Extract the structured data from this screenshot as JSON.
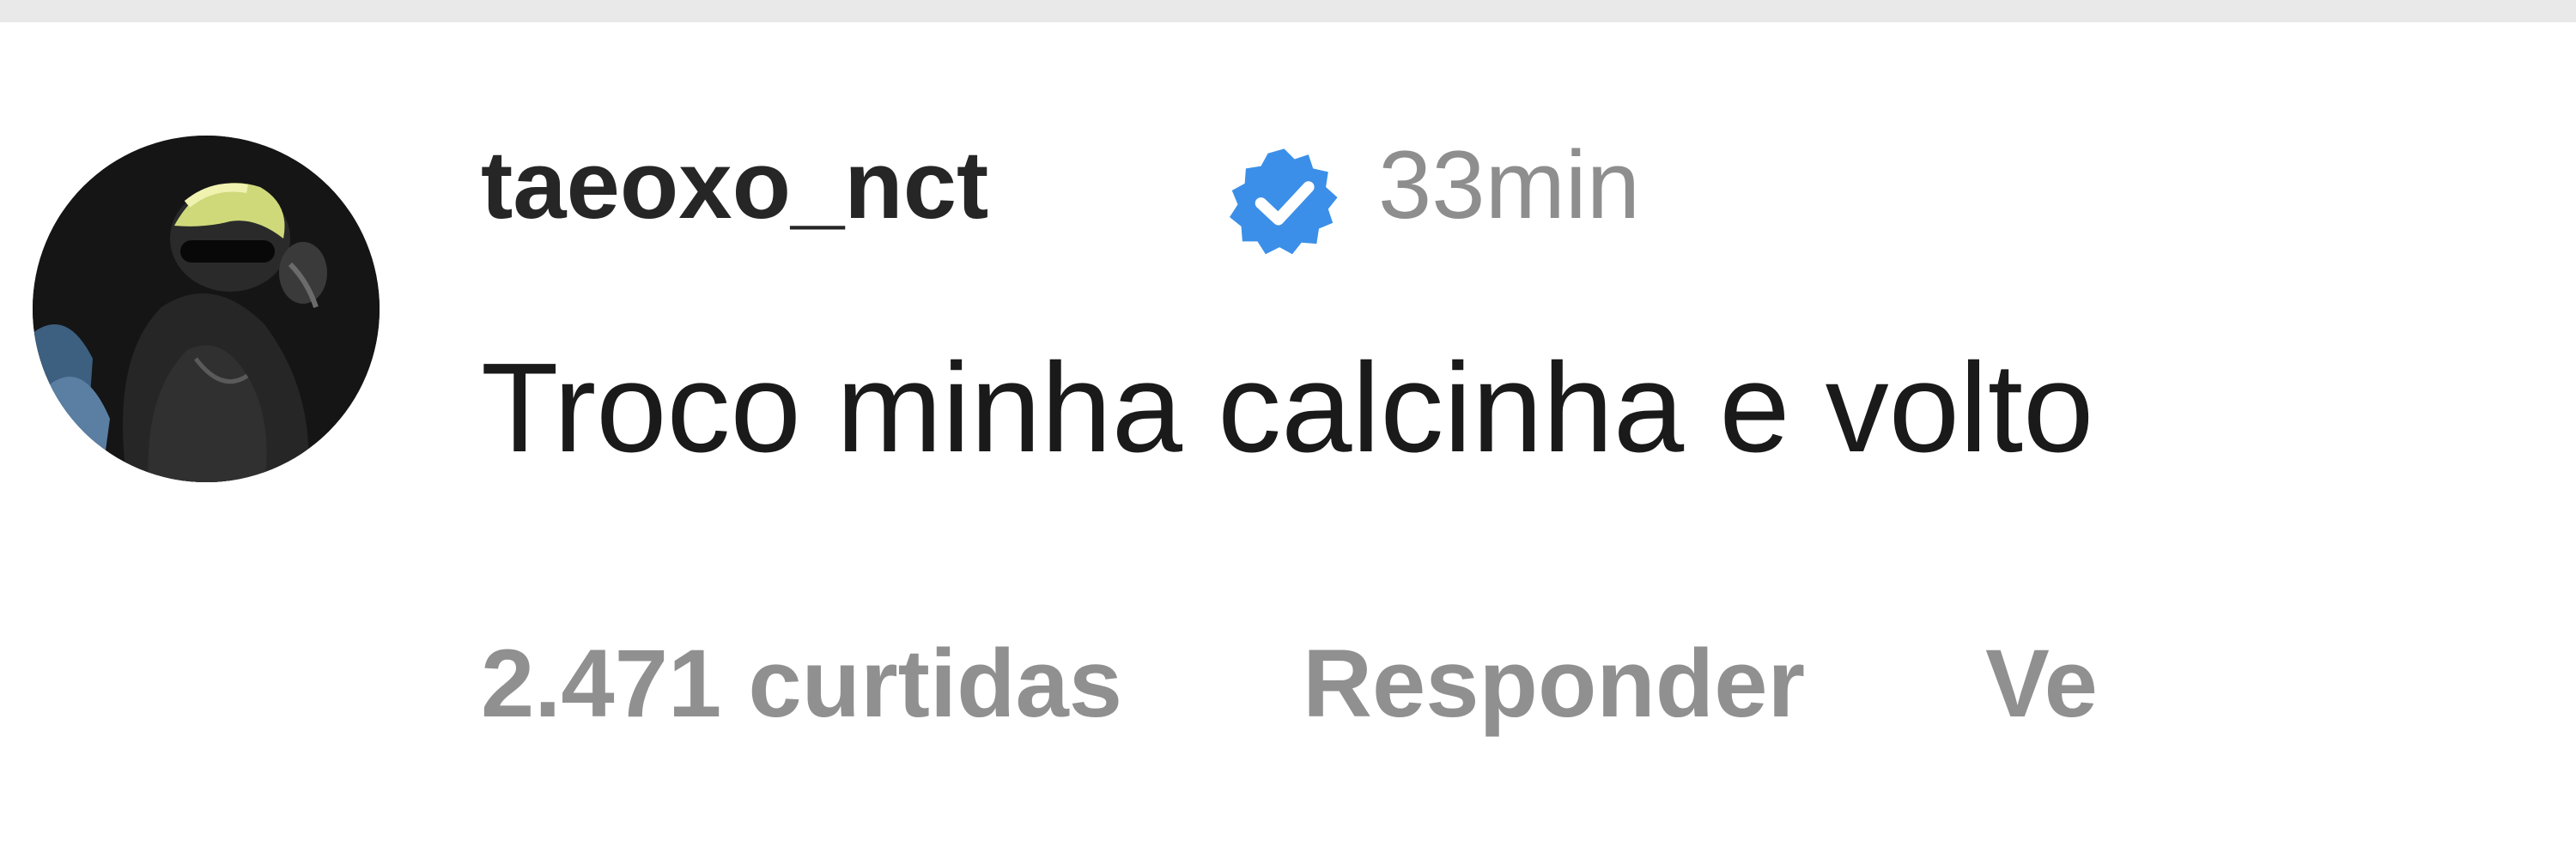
{
  "comment": {
    "username": "taeoxo_nct",
    "verified_icon": "verified-badge-icon",
    "timestamp": "33min",
    "text": "Troco minha calcinha e volto",
    "likes_label": "2.471 curtidas",
    "reply_label": "Responder",
    "more_label": "Ve"
  },
  "colors": {
    "username": "#262626",
    "secondary_text": "#8e8e8e",
    "verified_blue": "#3b8fe8",
    "background": "#ffffff"
  }
}
